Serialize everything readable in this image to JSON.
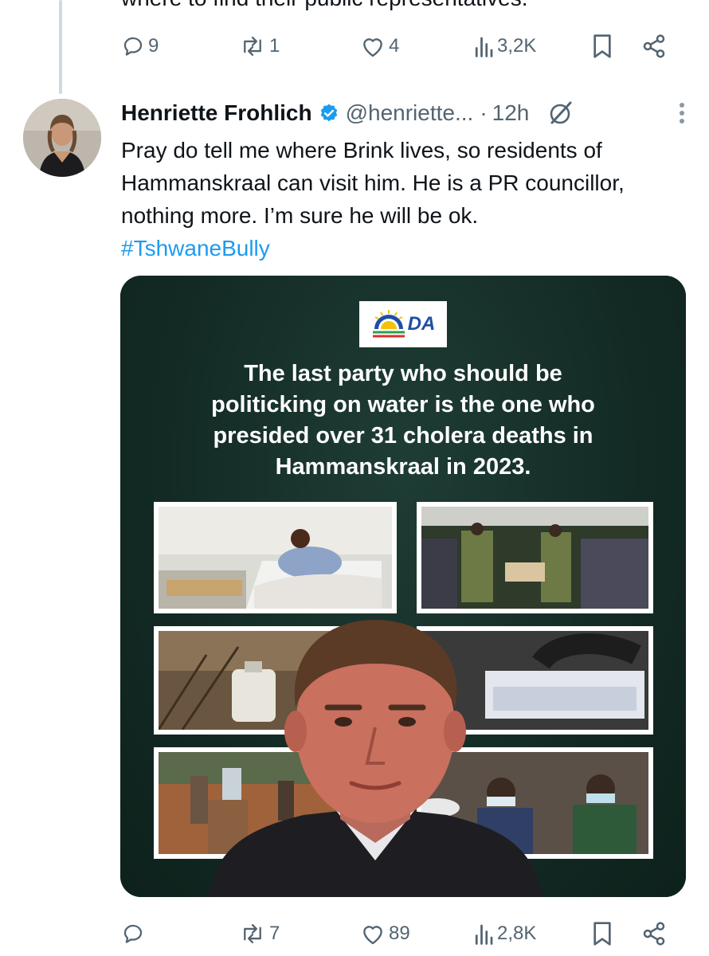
{
  "previous_tweet": {
    "cut_text": "where to find their public representatives.",
    "actions": {
      "replies": "9",
      "reposts": "1",
      "likes": "4",
      "views": "3,2K"
    }
  },
  "tweet": {
    "author_name": "Henriette Frohlich",
    "handle": "@henriette...",
    "separator": "·",
    "time": "12h",
    "text_lines": [
      "Pray do tell me where Brink lives, so residents of",
      "Hammanskraal can visit him. He is a PR councillor,",
      "nothing more. I’m sure he will be ok."
    ],
    "hashtag": "#TshwaneBully",
    "media": {
      "logo_text": "DA",
      "headline_lines": [
        "The last party who should be",
        "politicking on water is the one who",
        "presided over 31 cholera deaths in",
        "Hammanskraal in 2023."
      ]
    },
    "actions": {
      "replies": "",
      "reposts": "7",
      "likes": "89",
      "views": "2,8K"
    }
  },
  "colors": {
    "text": "#0f1419",
    "muted": "#536471",
    "link": "#1d9bf0",
    "verified": "#1d9bf0",
    "media_bg": "#15302a"
  }
}
